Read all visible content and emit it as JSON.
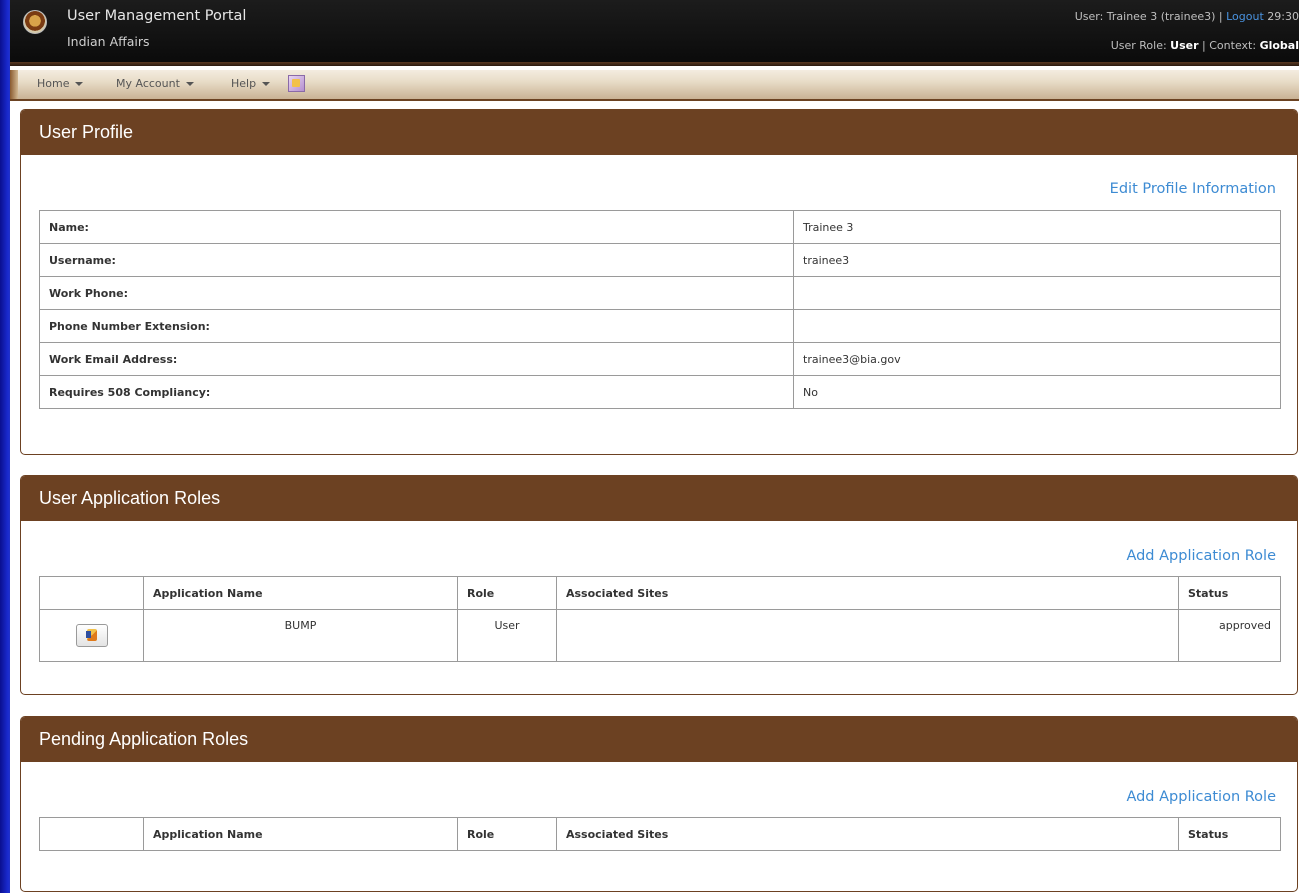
{
  "header": {
    "app_title": "User Management Portal",
    "org_name": "Indian Affairs",
    "user_prefix": "User: Trainee 3 (trainee3) |",
    "logout_label": "Logout",
    "session_timer": "29:30",
    "role_prefix": "User Role:",
    "role_value": "User",
    "context_prefix": "| Context:",
    "context_value": "Global"
  },
  "nav": {
    "items": [
      {
        "label": "Home"
      },
      {
        "label": "My Account"
      },
      {
        "label": "Help"
      }
    ]
  },
  "profile": {
    "title": "User Profile",
    "edit_link": "Edit Profile Information",
    "rows": [
      {
        "label": "Name:",
        "value": "Trainee 3"
      },
      {
        "label": "Username:",
        "value": "trainee3"
      },
      {
        "label": "Work Phone:",
        "value": ""
      },
      {
        "label": "Phone Number Extension:",
        "value": ""
      },
      {
        "label": "Work Email Address:",
        "value": "trainee3@bia.gov"
      },
      {
        "label": "Requires 508 Compliancy:",
        "value": "No"
      }
    ]
  },
  "app_roles": {
    "title": "User Application Roles",
    "add_link": "Add Application Role",
    "columns": [
      "",
      "Application Name",
      "Role",
      "Associated Sites",
      "Status"
    ],
    "rows": [
      {
        "application_name": "BUMP",
        "role": "User",
        "associated_sites": "",
        "status": "approved"
      }
    ]
  },
  "pending_roles": {
    "title": "Pending Application Roles",
    "add_link": "Add Application Role",
    "columns": [
      "",
      "Application Name",
      "Role",
      "Associated Sites",
      "Status"
    ]
  }
}
